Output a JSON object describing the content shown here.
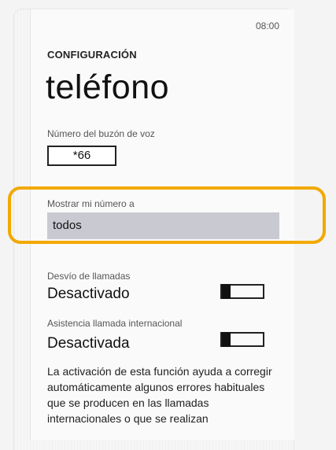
{
  "status_bar": {
    "time": "08:00"
  },
  "header": {
    "section": "CONFIGURACIÓN",
    "title": "teléfono"
  },
  "voicemail": {
    "label": "Número del buzón de voz",
    "value": "*66"
  },
  "caller_id": {
    "label": "Mostrar mi número a",
    "value": "todos"
  },
  "call_forwarding": {
    "label": "Desvío de llamadas",
    "status": "Desactivado",
    "enabled": false
  },
  "international_assist": {
    "label": "Asistencia llamada internacional",
    "status": "Desactivada",
    "enabled": false,
    "description": "La activación de esta función ayuda a corregir automáticamente algunos errores habituales que se producen en las llamadas internacionales o que se realizan"
  },
  "colors": {
    "highlight": "#f2a900",
    "select_background": "#c9c9d2"
  }
}
